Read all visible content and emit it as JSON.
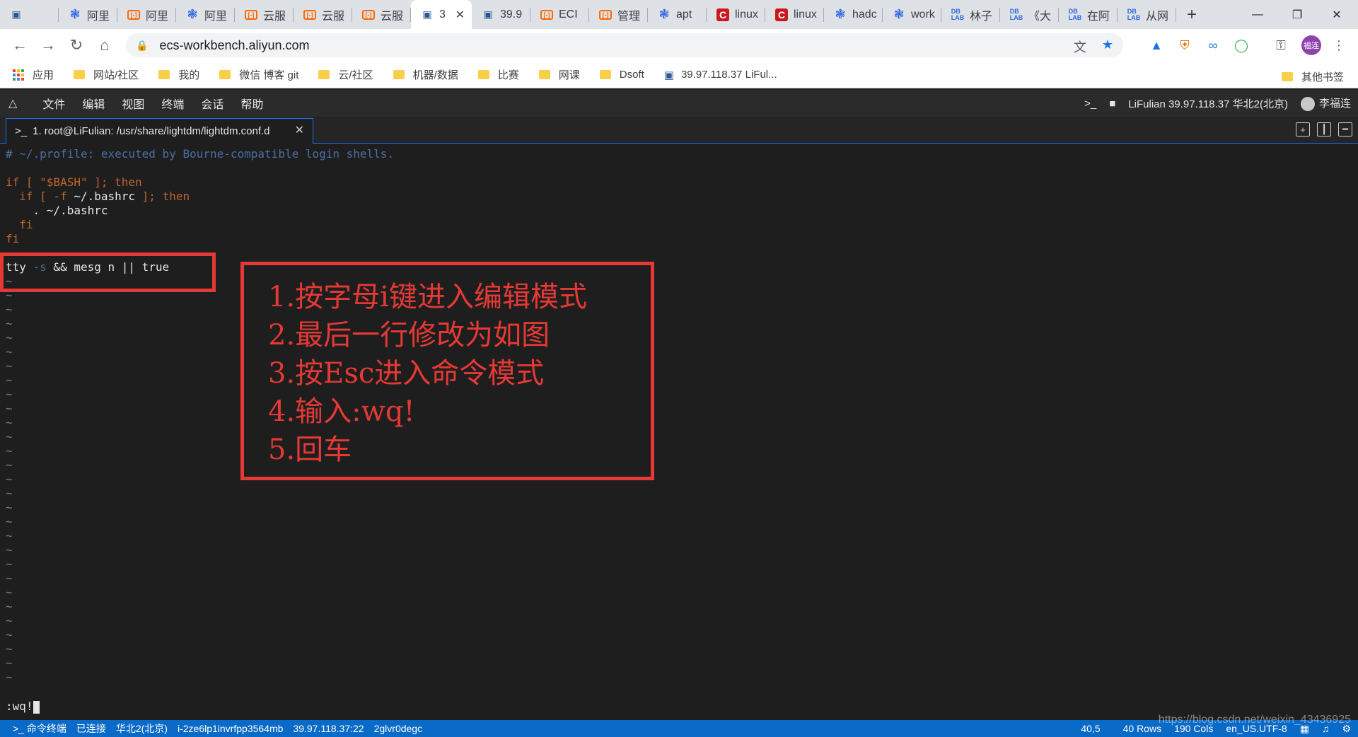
{
  "browser": {
    "tabs": [
      {
        "title": "",
        "icon": "remote-pc-icon"
      },
      {
        "title": "阿里",
        "icon": "baidu-paw-icon"
      },
      {
        "title": "阿里",
        "icon": "aliyun-icon"
      },
      {
        "title": "阿里",
        "icon": "baidu-paw-icon"
      },
      {
        "title": "云服",
        "icon": "aliyun-icon"
      },
      {
        "title": "云服",
        "icon": "aliyun-icon"
      },
      {
        "title": "云服",
        "icon": "aliyun-icon"
      },
      {
        "title": "3",
        "icon": "remote-pc-icon",
        "active": true
      },
      {
        "title": "39.9",
        "icon": "remote-pc-icon"
      },
      {
        "title": "ECI",
        "icon": "aliyun-icon"
      },
      {
        "title": "管理",
        "icon": "aliyun-icon"
      },
      {
        "title": "apt",
        "icon": "baidu-paw-icon"
      },
      {
        "title": "linux",
        "icon": "csdn-icon"
      },
      {
        "title": "linux",
        "icon": "csdn-icon"
      },
      {
        "title": "hadc",
        "icon": "baidu-paw-icon"
      },
      {
        "title": "work",
        "icon": "baidu-paw-icon"
      },
      {
        "title": "林子",
        "icon": "db-lab-icon"
      },
      {
        "title": "《大",
        "icon": "db-lab-icon"
      },
      {
        "title": "在阿",
        "icon": "db-lab-icon"
      },
      {
        "title": "从网",
        "icon": "db-lab-icon"
      }
    ],
    "url": "ecs-workbench.aliyun.com",
    "bookmarks": [
      "应用",
      "网站/社区",
      "我的",
      "微信 博客 git",
      "云/社区",
      "机器/数据",
      "比赛",
      "网课",
      "Dsoft",
      "39.97.118.37 LiFul..."
    ],
    "other_bookmarks": "其他书签",
    "profile_label": "福连"
  },
  "workbench": {
    "menu": [
      "文件",
      "编辑",
      "视图",
      "终端",
      "会话",
      "帮助"
    ],
    "server_info": "LiFulian 39.97.118.37 华北2(北京)",
    "user_name": "李福连",
    "terminal_tab": "1. root@LiFulian: /usr/share/lightdm/lightdm.conf.d"
  },
  "terminal": {
    "line1": "# ~/.profile: executed by Bourne-compatible login shells.",
    "line3a": "if [ ",
    "line3b": "\"$BASH\"",
    "line3c": " ]; then",
    "line4a": "  if [ ",
    "line4b": "-f",
    "line4c": " ~/.bashrc",
    "line4d": " ]; then",
    "line5": "    . ~/.bashrc",
    "line6": "  fi",
    "line7": "fi",
    "line9a": "tty ",
    "line9b": "-s",
    "line9c": " && mesg n || true",
    "tilde": "~",
    "tilde_count": 29,
    "command": ":wq!"
  },
  "annotation": {
    "steps": [
      "1.按字母i键进入编辑模式",
      "2.最后一行修改为如图",
      "3.按Esc进入命令模式",
      "4.输入:wq!",
      "5.回车"
    ]
  },
  "statusbar": {
    "mode": "命令终端",
    "connection": "已连接",
    "region": "华北2(北京)",
    "instance": "i-2ze6lp1invrfpp3564mb",
    "address": "39.97.118.37:22",
    "session": "2glvr0degc",
    "cursor_pos": "40,5",
    "rows": "40 Rows",
    "cols": "190 Cols",
    "encoding": "en_US.UTF-8"
  },
  "watermark": "https://blog.csdn.net/weixin_43436925",
  "colors": {
    "accent": "#1f6feb",
    "annotation_red": "#e53935",
    "status_blue": "#0a6ac7"
  }
}
